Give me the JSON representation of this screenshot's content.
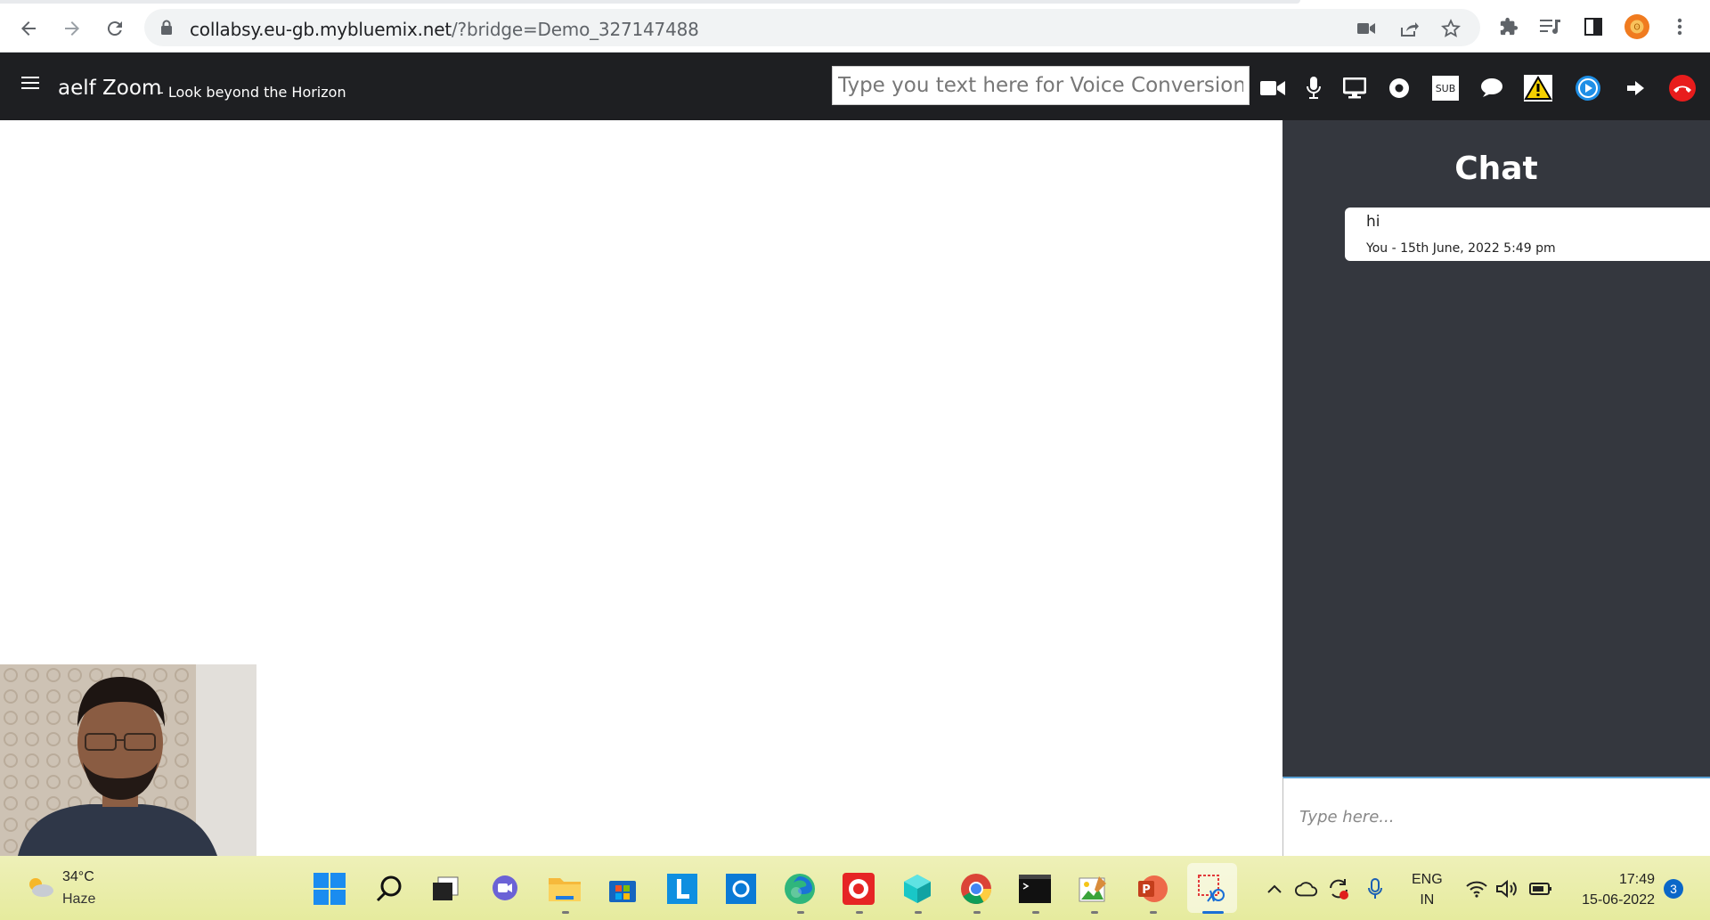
{
  "browser": {
    "url_host": "collabsy.eu-gb.mybluemix.net",
    "url_path": "/?bridge=Demo_327147488"
  },
  "app": {
    "title": "aelf Zoom",
    "subtitle": "- Look beyond the Horizon",
    "voice_placeholder": "Type you text here for Voice Conversion",
    "subtitle_btn": "SUB",
    "colors": {
      "header_bg": "#1e1f22",
      "end_call": "#e81c1c",
      "warning": "#f5d000",
      "accent_blue": "#1f8fe6"
    }
  },
  "chat": {
    "title": "Chat",
    "messages": [
      {
        "text": "hi",
        "meta": "You - 15th June, 2022 5:49 pm"
      }
    ],
    "input_placeholder": "Type here..."
  },
  "taskbar": {
    "weather_temp": "34°C",
    "weather_desc": "Haze",
    "lang_line1": "ENG",
    "lang_line2": "IN",
    "time": "17:49",
    "date": "15-06-2022",
    "notification_count": "3"
  }
}
